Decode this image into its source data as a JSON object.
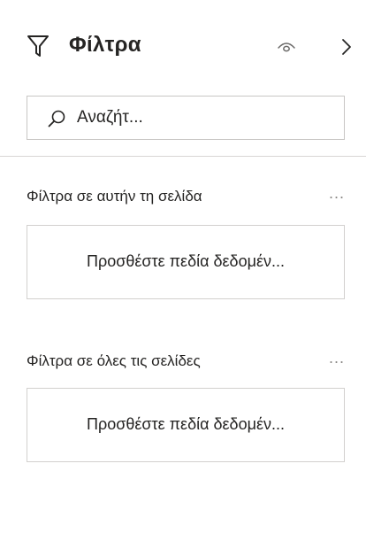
{
  "header": {
    "title": "Φίλτρα",
    "filter_icon": "filter-icon",
    "visibility_icon": "eye-icon",
    "collapse_icon": "chevron-right-icon"
  },
  "search": {
    "placeholder": "Αναζήτ...",
    "value": "",
    "icon": "search-icon"
  },
  "sections": [
    {
      "title": "Φίλτρα σε αυτήν τη σελίδα",
      "more_label": "...",
      "drop_text": "Προσθέστε πεδία δεδομέν..."
    },
    {
      "title": "Φίλτρα σε όλες τις σελίδες",
      "more_label": "...",
      "drop_text": "Προσθέστε πεδία δεδομέν..."
    }
  ],
  "colors": {
    "text": "#252423",
    "border": "#c8c6c4",
    "muted": "#8a8886",
    "background": "#ffffff"
  }
}
